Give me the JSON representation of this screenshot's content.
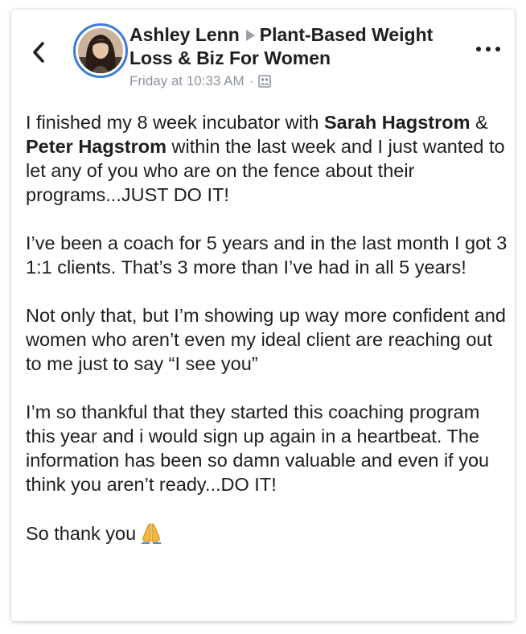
{
  "post": {
    "author": "Ashley Lenn",
    "group": "Plant-Based Weight Loss & Biz For Women",
    "timestamp": "Friday at 10:33 AM",
    "separator": "·",
    "privacy_icon": "members-group-icon",
    "paragraphs": {
      "p1_a": "I finished my 8 week incubator with ",
      "p1_mention1": "Sarah Hagstrom",
      "p1_b": " & ",
      "p1_mention2": "Peter Hagstrom",
      "p1_c": " within the last week and I just wanted to let any of you who are on the fence about their programs...JUST DO IT!",
      "p2": "I’ve been a coach for 5 years and in the last month I got 3 1:1 clients. That’s 3 more than I’ve had in all 5 years!",
      "p3": "Not only that, but I’m showing up way more confident and women who aren’t even my ideal client are reaching out to me just to say “I see you”",
      "p4": "I’m so thankful that they started this coaching program this year and i would sign up again in a heartbeat. The information has been so damn valuable and even if you think you aren’t ready...DO IT!",
      "p5": "So thank you"
    },
    "emoji": "folded-hands-icon"
  },
  "colors": {
    "text": "#1c1e21",
    "meta": "#8d949e",
    "avatar_ring": "#3b7bd8",
    "emoji": "#f5b83d"
  }
}
